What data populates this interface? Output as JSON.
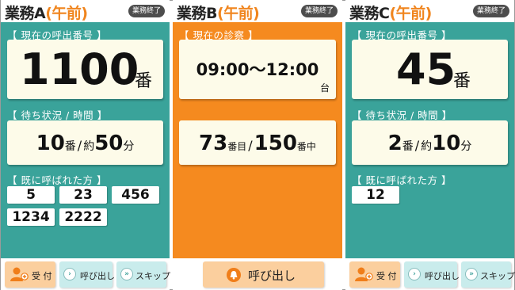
{
  "panelA": {
    "title": "業務A",
    "title_sub": "(午前)",
    "end_label": "業務終了",
    "current_label": "【 現在の呼出番号 】",
    "current_number": "1100",
    "number_unit": "番",
    "wait_label": "【 待ち状況 / 時間 】",
    "wait_count": "10",
    "wait_count_unit": "番",
    "wait_sep": "/",
    "approx": "約",
    "wait_time": "50",
    "wait_time_unit": "分",
    "called_label": "【 既に呼ばれた方 】",
    "called": [
      "5",
      "23",
      "456",
      "1234",
      "2222"
    ],
    "btn_reception": "受 付",
    "btn_call": "呼び出し",
    "btn_skip": "スキップ"
  },
  "panelB": {
    "title": "業務B",
    "title_sub": "(午前)",
    "end_label": "業務終了",
    "current_label": "【 現在の診察 】",
    "time_range": "09:00～12:00",
    "room_unit": "台",
    "progress_current": "73",
    "progress_current_unit": "番目",
    "progress_sep": "/",
    "progress_total": "150",
    "progress_total_unit": "番中",
    "btn_call": "呼び出し"
  },
  "panelC": {
    "title": "業務C",
    "title_sub": "(午前)",
    "end_label": "業務終了",
    "current_label": "【 現在の呼出番号 】",
    "current_number": "45",
    "number_unit": "番",
    "wait_label": "【 待ち状況 / 時間 】",
    "wait_count": "2",
    "wait_count_unit": "番",
    "wait_sep": "/",
    "approx": "約",
    "wait_time": "10",
    "wait_time_unit": "分",
    "called_label": "【 既に呼ばれた方 】",
    "called": [
      "12"
    ],
    "btn_reception": "受 付",
    "btn_call": "呼び出し",
    "btn_skip": "スキップ"
  },
  "colors": {
    "teal": "#3aa39a",
    "orange": "#f58a1f",
    "title_accent": "#f0851e",
    "card": "#fdfbe9",
    "end_button": "#4d4d4d",
    "button_peach": "#fbcf9e",
    "button_aqua": "#c9ecec"
  },
  "icons": {
    "reception": "person-add-icon",
    "call": "chevron-right-icon",
    "skip": "double-chevron-right-icon",
    "bell": "bell-icon"
  }
}
